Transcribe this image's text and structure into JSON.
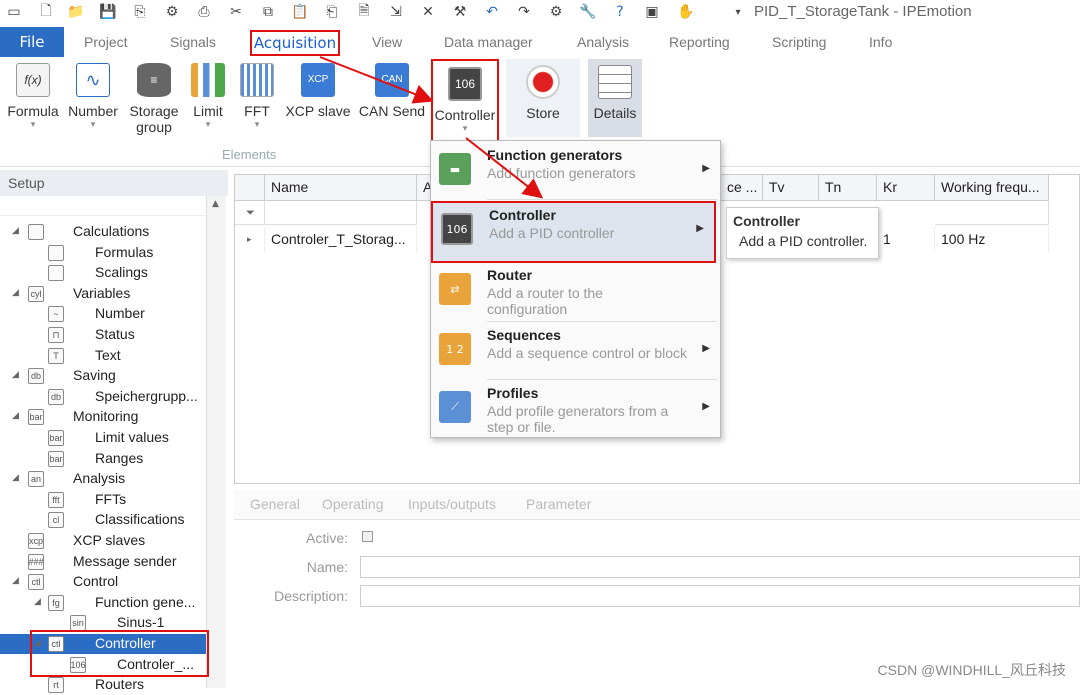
{
  "title": "PID_T_StorageTank - IPEmotion",
  "menu": {
    "file": "File",
    "items": [
      "Project",
      "Signals",
      "Acquisition",
      "View",
      "Data manager",
      "Analysis",
      "Reporting",
      "Scripting",
      "Info"
    ]
  },
  "ribbon": {
    "buttons": [
      {
        "label": "Formula",
        "icon": "f(x)"
      },
      {
        "label": "Number",
        "icon": "sine-icon"
      },
      {
        "label": "Storage\ngroup",
        "icon": "database-icon"
      },
      {
        "label": "Limit",
        "icon": "bar-limit-icon"
      },
      {
        "label": "FFT",
        "icon": "fft-icon"
      },
      {
        "label": "XCP slave",
        "icon": "xcp-icon"
      },
      {
        "label": "CAN Send",
        "icon": "can-icon"
      },
      {
        "label": "Controller",
        "icon": "106"
      },
      {
        "label": "Store",
        "icon": "record-icon"
      },
      {
        "label": "Details",
        "icon": "details-icon"
      }
    ],
    "group_label": "Elements",
    "xcp_icon_text": "XCP",
    "can_icon_text": "CAN",
    "controller_icon_text": "106"
  },
  "setup": {
    "title": "Setup",
    "tree": [
      {
        "label": "Calculations",
        "level": 0,
        "icon": "f(x)"
      },
      {
        "label": "Formulas",
        "level": 1,
        "icon": "f(x)"
      },
      {
        "label": "Scalings",
        "level": 1,
        "icon": "scale"
      },
      {
        "label": "Variables",
        "level": 0,
        "icon": "cyl"
      },
      {
        "label": "Number",
        "level": 1,
        "icon": "~"
      },
      {
        "label": "Status",
        "level": 1,
        "icon": "⊓"
      },
      {
        "label": "Text",
        "level": 1,
        "icon": "T"
      },
      {
        "label": "Saving",
        "level": 0,
        "icon": "db"
      },
      {
        "label": "Speichergrupp...",
        "level": 1,
        "icon": "db"
      },
      {
        "label": "Monitoring",
        "level": 0,
        "icon": "bar"
      },
      {
        "label": "Limit values",
        "level": 1,
        "icon": "bar"
      },
      {
        "label": "Ranges",
        "level": 1,
        "icon": "bar"
      },
      {
        "label": "Analysis",
        "level": 0,
        "icon": "an"
      },
      {
        "label": "FFTs",
        "level": 1,
        "icon": "fft"
      },
      {
        "label": "Classifications",
        "level": 1,
        "icon": "cl"
      },
      {
        "label": "XCP slaves",
        "level": 0,
        "icon": "xcp"
      },
      {
        "label": "Message sender",
        "level": 0,
        "icon": "###"
      },
      {
        "label": "Control",
        "level": 0,
        "icon": "ctl"
      },
      {
        "label": "Function gene...",
        "level": 1,
        "icon": "fg"
      },
      {
        "label": "Sinus-1",
        "level": 2,
        "icon": "sin"
      },
      {
        "label": "Controller",
        "level": 1,
        "icon": "ctl"
      },
      {
        "label": "Controler_...",
        "level": 2,
        "icon": "106"
      },
      {
        "label": "Routers",
        "level": 1,
        "icon": "rt"
      }
    ]
  },
  "grid": {
    "columns": [
      "Name",
      "A",
      "ce ...",
      "Tv",
      "Tn",
      "Kr",
      "Working frequ..."
    ],
    "row": {
      "name": "Controler_T_Storag...",
      "kr": "1",
      "freq": "100 Hz"
    },
    "filter_icon": "funnel-icon"
  },
  "detail": {
    "tabs": [
      "General",
      "Operating",
      "Inputs/outputs",
      "Parameter"
    ],
    "active_label": "Active:",
    "name_label": "Name:",
    "description_label": "Description:"
  },
  "dropdown": {
    "items": [
      {
        "title": "Function generators",
        "desc": "Add function generators",
        "submenu": true
      },
      {
        "title": "Controller",
        "desc": "Add a PID controller",
        "submenu": true
      },
      {
        "title": "Router",
        "desc": "Add a router to the configuration",
        "submenu": false
      },
      {
        "title": "Sequences",
        "desc": "Add a sequence control or block",
        "submenu": true
      },
      {
        "title": "Profiles",
        "desc": "Add profile generators from a step or file.",
        "submenu": true
      }
    ]
  },
  "tooltip": {
    "title": "Controller",
    "desc": "Add a PID controller."
  },
  "watermark": "CSDN @WINDHILL_风丘科技",
  "colors": {
    "accent": "#2b6cc4",
    "highlight": "#e01010"
  }
}
